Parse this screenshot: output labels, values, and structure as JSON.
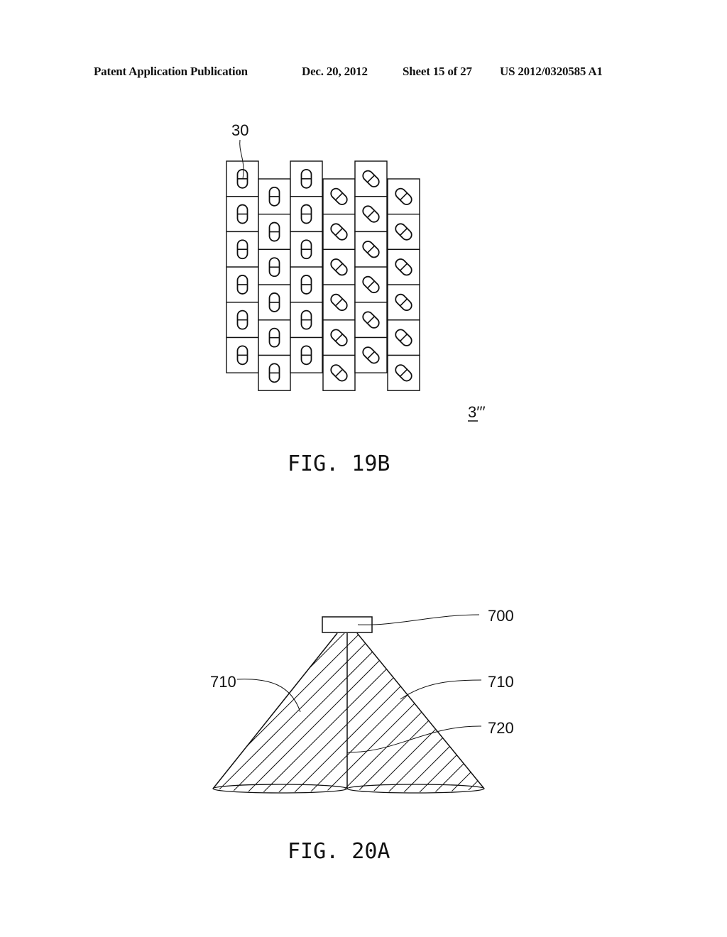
{
  "header": {
    "publication": "Patent Application Publication",
    "date": "Dec. 20, 2012",
    "sheet": "Sheet 15 of 27",
    "patent_number": "US 2012/0320585 A1"
  },
  "fig19b": {
    "caption": "FIG. 19B",
    "ref_label": "30",
    "array_label": "3′′′",
    "columns": [
      {
        "orientation": "vertical",
        "offset": "high",
        "cells": 6
      },
      {
        "orientation": "vertical",
        "offset": "low",
        "cells": 6
      },
      {
        "orientation": "vertical",
        "offset": "high",
        "cells": 6
      },
      {
        "orientation": "diagonal",
        "offset": "low",
        "cells": 6
      },
      {
        "orientation": "diagonal",
        "offset": "high",
        "cells": 6
      },
      {
        "orientation": "diagonal",
        "offset": "low",
        "cells": 6
      }
    ]
  },
  "fig20a": {
    "caption": "FIG. 20A",
    "labels": {
      "source": "700",
      "beam_left": "710",
      "beam_right": "710",
      "divider": "720"
    }
  }
}
